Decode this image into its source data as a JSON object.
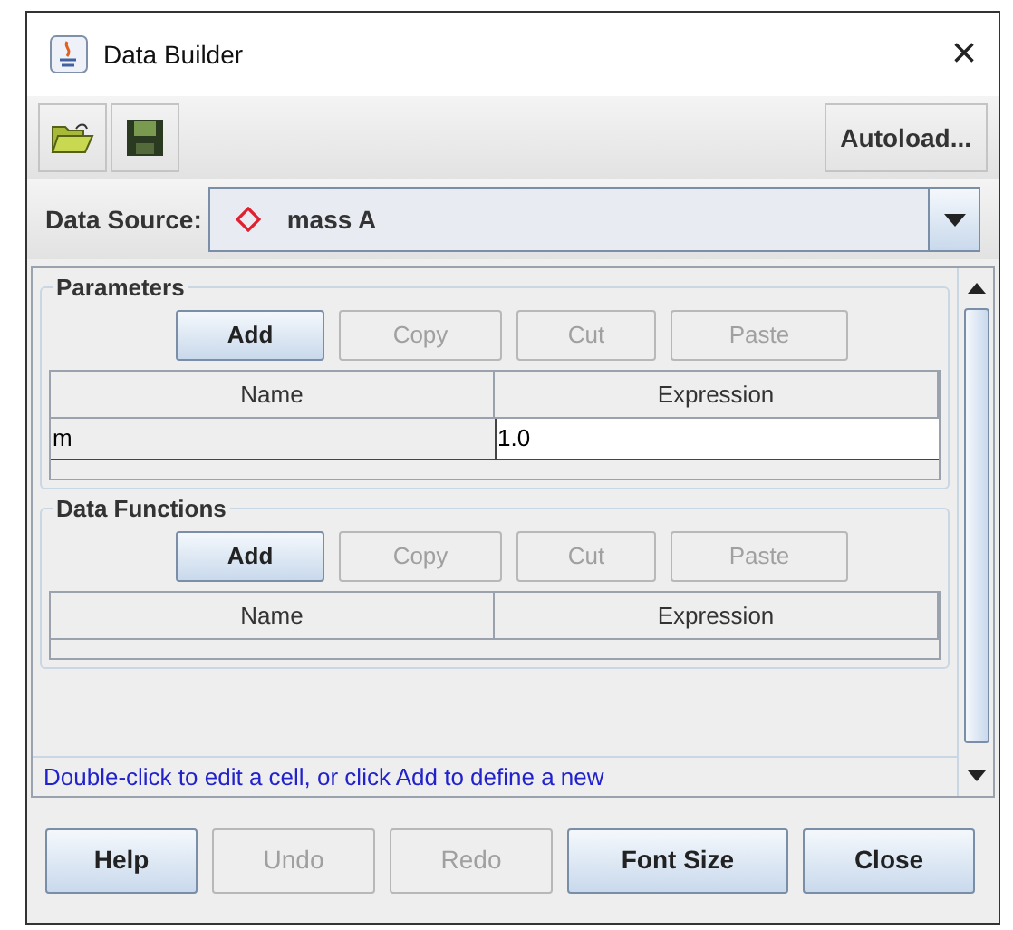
{
  "window": {
    "title": "Data Builder",
    "close": "×"
  },
  "toolbar": {
    "autoload": "Autoload..."
  },
  "data_source": {
    "label": "Data Source:",
    "value": "mass A"
  },
  "sections": [
    {
      "title": "Parameters",
      "buttons": [
        {
          "label": "Add",
          "disabled": false
        },
        {
          "label": "Copy",
          "disabled": true
        },
        {
          "label": "Cut",
          "disabled": true
        },
        {
          "label": "Paste",
          "disabled": true
        }
      ],
      "columns": [
        "Name",
        "Expression"
      ],
      "rows": [
        [
          "m",
          "1.0"
        ]
      ]
    },
    {
      "title": "Data Functions",
      "buttons": [
        {
          "label": "Add",
          "disabled": false
        },
        {
          "label": "Copy",
          "disabled": true
        },
        {
          "label": "Cut",
          "disabled": true
        },
        {
          "label": "Paste",
          "disabled": true
        }
      ],
      "columns": [
        "Name",
        "Expression"
      ]
    }
  ],
  "status": "Double-click to edit a cell, or click Add to define a new",
  "buttons": [
    {
      "label": "Help",
      "disabled": false
    },
    {
      "label": "Undo",
      "disabled": true
    },
    {
      "label": "Redo",
      "disabled": true
    },
    {
      "label": "Font Size",
      "disabled": false
    },
    {
      "label": "Close",
      "disabled": false
    }
  ]
}
